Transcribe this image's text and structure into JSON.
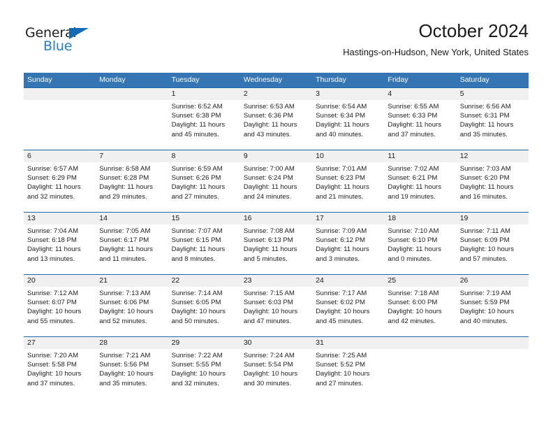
{
  "brand": {
    "name_top": "General",
    "name_bottom": "Blue",
    "triangle_color": "#156bb5",
    "blue_color": "#1e7fd4"
  },
  "header": {
    "month_title": "October 2024",
    "location": "Hastings-on-Hudson, New York, United States"
  },
  "theme": {
    "header_blue": "#3575b4",
    "row_rule_blue": "#1d68ab",
    "daynum_band": "#f0f0f0",
    "text": "#212121"
  },
  "calendar": {
    "weekdays": [
      "Sunday",
      "Monday",
      "Tuesday",
      "Wednesday",
      "Thursday",
      "Friday",
      "Saturday"
    ],
    "weeks": [
      {
        "days": [
          {
            "num": "",
            "sunrise": "",
            "sunset": "",
            "daylight_1": "",
            "daylight_2": ""
          },
          {
            "num": "",
            "sunrise": "",
            "sunset": "",
            "daylight_1": "",
            "daylight_2": ""
          },
          {
            "num": "1",
            "sunrise": "Sunrise: 6:52 AM",
            "sunset": "Sunset: 6:38 PM",
            "daylight_1": "Daylight: 11 hours",
            "daylight_2": "and 45 minutes."
          },
          {
            "num": "2",
            "sunrise": "Sunrise: 6:53 AM",
            "sunset": "Sunset: 6:36 PM",
            "daylight_1": "Daylight: 11 hours",
            "daylight_2": "and 43 minutes."
          },
          {
            "num": "3",
            "sunrise": "Sunrise: 6:54 AM",
            "sunset": "Sunset: 6:34 PM",
            "daylight_1": "Daylight: 11 hours",
            "daylight_2": "and 40 minutes."
          },
          {
            "num": "4",
            "sunrise": "Sunrise: 6:55 AM",
            "sunset": "Sunset: 6:33 PM",
            "daylight_1": "Daylight: 11 hours",
            "daylight_2": "and 37 minutes."
          },
          {
            "num": "5",
            "sunrise": "Sunrise: 6:56 AM",
            "sunset": "Sunset: 6:31 PM",
            "daylight_1": "Daylight: 11 hours",
            "daylight_2": "and 35 minutes."
          }
        ]
      },
      {
        "days": [
          {
            "num": "6",
            "sunrise": "Sunrise: 6:57 AM",
            "sunset": "Sunset: 6:29 PM",
            "daylight_1": "Daylight: 11 hours",
            "daylight_2": "and 32 minutes."
          },
          {
            "num": "7",
            "sunrise": "Sunrise: 6:58 AM",
            "sunset": "Sunset: 6:28 PM",
            "daylight_1": "Daylight: 11 hours",
            "daylight_2": "and 29 minutes."
          },
          {
            "num": "8",
            "sunrise": "Sunrise: 6:59 AM",
            "sunset": "Sunset: 6:26 PM",
            "daylight_1": "Daylight: 11 hours",
            "daylight_2": "and 27 minutes."
          },
          {
            "num": "9",
            "sunrise": "Sunrise: 7:00 AM",
            "sunset": "Sunset: 6:24 PM",
            "daylight_1": "Daylight: 11 hours",
            "daylight_2": "and 24 minutes."
          },
          {
            "num": "10",
            "sunrise": "Sunrise: 7:01 AM",
            "sunset": "Sunset: 6:23 PM",
            "daylight_1": "Daylight: 11 hours",
            "daylight_2": "and 21 minutes."
          },
          {
            "num": "11",
            "sunrise": "Sunrise: 7:02 AM",
            "sunset": "Sunset: 6:21 PM",
            "daylight_1": "Daylight: 11 hours",
            "daylight_2": "and 19 minutes."
          },
          {
            "num": "12",
            "sunrise": "Sunrise: 7:03 AM",
            "sunset": "Sunset: 6:20 PM",
            "daylight_1": "Daylight: 11 hours",
            "daylight_2": "and 16 minutes."
          }
        ]
      },
      {
        "days": [
          {
            "num": "13",
            "sunrise": "Sunrise: 7:04 AM",
            "sunset": "Sunset: 6:18 PM",
            "daylight_1": "Daylight: 11 hours",
            "daylight_2": "and 13 minutes."
          },
          {
            "num": "14",
            "sunrise": "Sunrise: 7:05 AM",
            "sunset": "Sunset: 6:17 PM",
            "daylight_1": "Daylight: 11 hours",
            "daylight_2": "and 11 minutes."
          },
          {
            "num": "15",
            "sunrise": "Sunrise: 7:07 AM",
            "sunset": "Sunset: 6:15 PM",
            "daylight_1": "Daylight: 11 hours",
            "daylight_2": "and 8 minutes."
          },
          {
            "num": "16",
            "sunrise": "Sunrise: 7:08 AM",
            "sunset": "Sunset: 6:13 PM",
            "daylight_1": "Daylight: 11 hours",
            "daylight_2": "and 5 minutes."
          },
          {
            "num": "17",
            "sunrise": "Sunrise: 7:09 AM",
            "sunset": "Sunset: 6:12 PM",
            "daylight_1": "Daylight: 11 hours",
            "daylight_2": "and 3 minutes."
          },
          {
            "num": "18",
            "sunrise": "Sunrise: 7:10 AM",
            "sunset": "Sunset: 6:10 PM",
            "daylight_1": "Daylight: 11 hours",
            "daylight_2": "and 0 minutes."
          },
          {
            "num": "19",
            "sunrise": "Sunrise: 7:11 AM",
            "sunset": "Sunset: 6:09 PM",
            "daylight_1": "Daylight: 10 hours",
            "daylight_2": "and 57 minutes."
          }
        ]
      },
      {
        "days": [
          {
            "num": "20",
            "sunrise": "Sunrise: 7:12 AM",
            "sunset": "Sunset: 6:07 PM",
            "daylight_1": "Daylight: 10 hours",
            "daylight_2": "and 55 minutes."
          },
          {
            "num": "21",
            "sunrise": "Sunrise: 7:13 AM",
            "sunset": "Sunset: 6:06 PM",
            "daylight_1": "Daylight: 10 hours",
            "daylight_2": "and 52 minutes."
          },
          {
            "num": "22",
            "sunrise": "Sunrise: 7:14 AM",
            "sunset": "Sunset: 6:05 PM",
            "daylight_1": "Daylight: 10 hours",
            "daylight_2": "and 50 minutes."
          },
          {
            "num": "23",
            "sunrise": "Sunrise: 7:15 AM",
            "sunset": "Sunset: 6:03 PM",
            "daylight_1": "Daylight: 10 hours",
            "daylight_2": "and 47 minutes."
          },
          {
            "num": "24",
            "sunrise": "Sunrise: 7:17 AM",
            "sunset": "Sunset: 6:02 PM",
            "daylight_1": "Daylight: 10 hours",
            "daylight_2": "and 45 minutes."
          },
          {
            "num": "25",
            "sunrise": "Sunrise: 7:18 AM",
            "sunset": "Sunset: 6:00 PM",
            "daylight_1": "Daylight: 10 hours",
            "daylight_2": "and 42 minutes."
          },
          {
            "num": "26",
            "sunrise": "Sunrise: 7:19 AM",
            "sunset": "Sunset: 5:59 PM",
            "daylight_1": "Daylight: 10 hours",
            "daylight_2": "and 40 minutes."
          }
        ]
      },
      {
        "days": [
          {
            "num": "27",
            "sunrise": "Sunrise: 7:20 AM",
            "sunset": "Sunset: 5:58 PM",
            "daylight_1": "Daylight: 10 hours",
            "daylight_2": "and 37 minutes."
          },
          {
            "num": "28",
            "sunrise": "Sunrise: 7:21 AM",
            "sunset": "Sunset: 5:56 PM",
            "daylight_1": "Daylight: 10 hours",
            "daylight_2": "and 35 minutes."
          },
          {
            "num": "29",
            "sunrise": "Sunrise: 7:22 AM",
            "sunset": "Sunset: 5:55 PM",
            "daylight_1": "Daylight: 10 hours",
            "daylight_2": "and 32 minutes."
          },
          {
            "num": "30",
            "sunrise": "Sunrise: 7:24 AM",
            "sunset": "Sunset: 5:54 PM",
            "daylight_1": "Daylight: 10 hours",
            "daylight_2": "and 30 minutes."
          },
          {
            "num": "31",
            "sunrise": "Sunrise: 7:25 AM",
            "sunset": "Sunset: 5:52 PM",
            "daylight_1": "Daylight: 10 hours",
            "daylight_2": "and 27 minutes."
          },
          {
            "num": "",
            "sunrise": "",
            "sunset": "",
            "daylight_1": "",
            "daylight_2": ""
          },
          {
            "num": "",
            "sunrise": "",
            "sunset": "",
            "daylight_1": "",
            "daylight_2": ""
          }
        ]
      }
    ]
  }
}
